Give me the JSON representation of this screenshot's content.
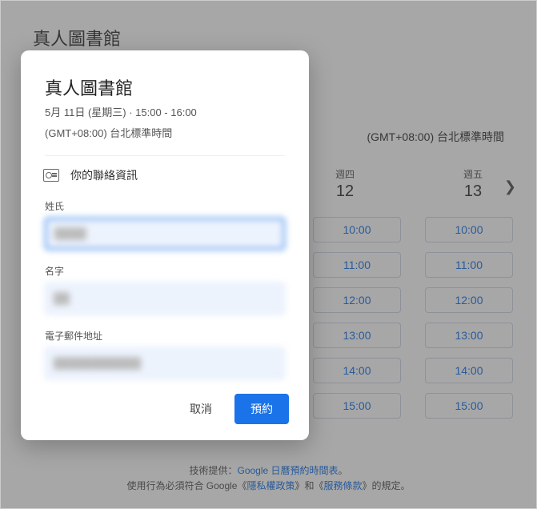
{
  "page": {
    "title": "真人圖書館",
    "timezone": "(GMT+08:00) 台北標準時間"
  },
  "days": [
    {
      "name": "週四",
      "num": "12"
    },
    {
      "name": "週五",
      "num": "13"
    }
  ],
  "slots": [
    "10:00",
    "11:00",
    "12:00",
    "13:00",
    "14:00",
    "15:00"
  ],
  "footer": {
    "line1_prefix": "技術提供：",
    "line1_link": "Google 日曆預約時間表",
    "line1_suffix": "。",
    "line2_prefix": "使用行為必須符合 Google《",
    "privacy": "隱私權政策",
    "mid": "》和《",
    "terms": "服務條款",
    "line2_suffix": "》的規定。"
  },
  "modal": {
    "title": "真人圖書館",
    "date_line": "5月 11日 (星期三) · 15:00 - 16:00",
    "tz_line": "(GMT+08:00) 台北標準時間",
    "contact_heading": "你的聯絡資訊",
    "fields": {
      "lastname": {
        "label": "姓氏",
        "value": "████"
      },
      "firstname": {
        "label": "名字",
        "value": "██"
      },
      "email": {
        "label": "電子郵件地址",
        "value": "███████████"
      }
    },
    "cancel": "取消",
    "submit": "預約"
  }
}
